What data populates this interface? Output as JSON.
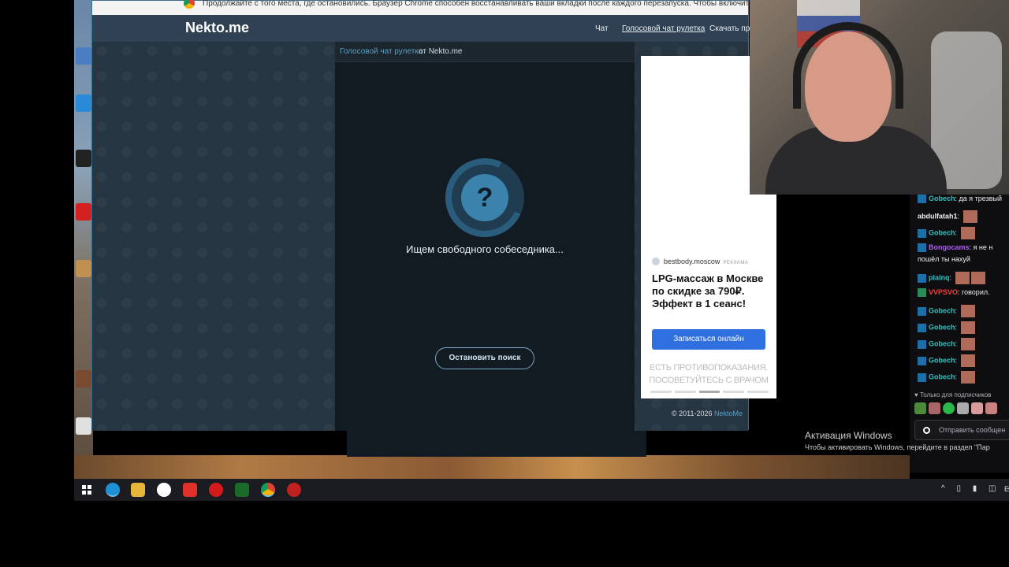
{
  "browser": {
    "infobar_text": "Продолжайте с того места, где остановились. Браузер Chrome способен восстанавливать ваши вкладки после каждого перезапуска. Чтобы включить эту функцию, откройте",
    "brand": "Nekto.me",
    "nav": [
      {
        "label": "Чат",
        "active": false
      },
      {
        "label": "Голосовой чат рулетка",
        "active": true
      },
      {
        "label": "Скачать прил",
        "active": false
      }
    ]
  },
  "chat_panel": {
    "breadcrumb_link": "Голосовой чат рулетка",
    "breadcrumb_rest": "от Nekto.me",
    "icon_glyph": "?",
    "status_text": "Ищем свободного собеседника...",
    "stop_button": "Остановить поиск"
  },
  "ad": {
    "advertiser": "bestbody.moscow",
    "badge": "РЕКЛАМА",
    "headline": "LPG-массаж в Москве по скидке за 790₽. Эффект в 1 сеанс!",
    "button": "Записаться онлайн",
    "warning": "ЕСТЬ ПРОТИВОПОКАЗАНИЯ. ПОСОВЕТУЙТЕСЬ С ВРАЧОМ"
  },
  "footer": {
    "copyright": "© 2011-2026",
    "copyright_link": "NektoMe"
  },
  "stream_chat": {
    "messages": [
      {
        "user": "Gobech",
        "text": "да я трезвый",
        "color": "#2dc4c4"
      },
      {
        "user": "abdulfatah1",
        "text": "",
        "color": "#efeff1"
      },
      {
        "user": "Gobech",
        "text": "",
        "color": "#2dc4c4"
      },
      {
        "user": "Bongocams",
        "text": "я не н",
        "color": "#b25cff",
        "text2": "пошёл ты нахуй"
      },
      {
        "user": "plainq",
        "text": "",
        "color": "#2dc4c4"
      },
      {
        "user": "VVPSVO",
        "text": "говорил.",
        "color": "#ff3b3b"
      },
      {
        "user": "Gobech",
        "text": "",
        "color": "#2dc4c4"
      },
      {
        "user": "Gobech",
        "text": "",
        "color": "#2dc4c4"
      },
      {
        "user": "Gobech",
        "text": "",
        "color": "#2dc4c4"
      },
      {
        "user": "Gobech",
        "text": "",
        "color": "#2dc4c4"
      },
      {
        "user": "Gobech",
        "text": "",
        "color": "#2dc4c4"
      }
    ],
    "subs_only": "Только для подписчиков",
    "input_placeholder": "Отправить сообщен"
  },
  "windows": {
    "activation_title": "Активация Windows",
    "activation_text": "Чтобы активировать Windows, перейдите в раздел \"Пар",
    "language": "ЕN"
  },
  "icons": [
    "chrome-icon",
    "question-icon",
    "start-icon",
    "edge-icon",
    "explorer-icon",
    "yandex-icon",
    "opera-icon"
  ]
}
